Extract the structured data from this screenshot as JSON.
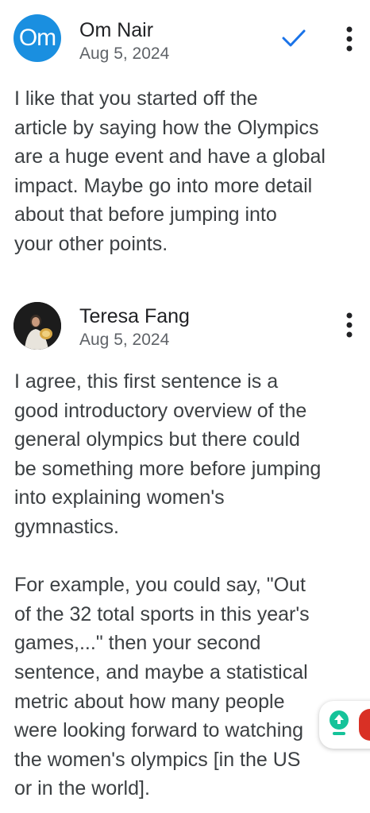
{
  "comments": [
    {
      "author": "Om Nair",
      "date": "Aug 5, 2024",
      "avatar_initials": "Om",
      "avatar_color": "#1a8fe0",
      "text": "I like that you started off the\narticle by saying how the Olympics\nare a huge event and have a global\nimpact. Maybe go into more detail\nabout that before jumping into\nyour other points.",
      "actions": [
        "check-icon",
        "more-vert-icon"
      ]
    },
    {
      "author": "Teresa Fang",
      "date": "Aug 5, 2024",
      "avatar": "profile-photo",
      "text": "I agree, this first sentence is a\ngood introductory overview of the\ngeneral olympics but there could\nbe something more before jumping\ninto explaining women's\ngymnastics.\n\nFor example, you could say, \"Out\nof the 32 total sports in this year's\ngames,...\" then your second\nsentence, and maybe a statistical\nmetric about how many people\nwere looking forward to watching\nthe women's olympics [in the US\nor in the world].",
      "actions": [
        "more-vert-icon"
      ]
    }
  ],
  "colors": {
    "accent": "#1a73e8",
    "grammarly": "#15c39a"
  }
}
